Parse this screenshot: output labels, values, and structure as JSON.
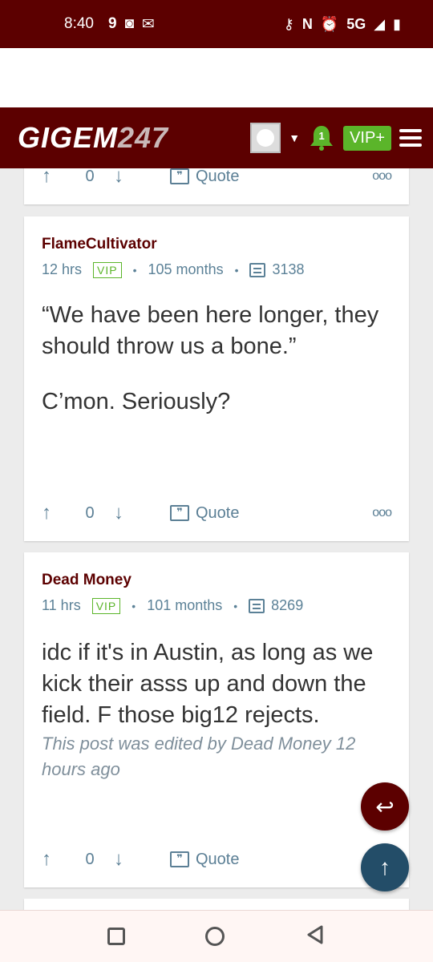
{
  "status_bar": {
    "time": "8:40",
    "network": "5G"
  },
  "site": {
    "logo_main": "GIGEM",
    "logo_num": "247",
    "notification_count": "1",
    "vip_label": "VIP+"
  },
  "posts": [
    {
      "username": "FlameCultivator",
      "time": "12 hrs",
      "vip": "VIP",
      "tenure": "105 months",
      "post_count": "3138",
      "body": [
        "“We have been here longer, they should throw us a bone.”",
        "C’mon. Seriously?"
      ],
      "votes": "0",
      "quote_label": "Quote"
    },
    {
      "username": "Dead Money",
      "time": "11 hrs",
      "vip": "VIP",
      "tenure": "101 months",
      "post_count": "8269",
      "body": [
        "idc if it's in Austin, as long as we kick their asss up and down the field. F those big12 rejects."
      ],
      "edited_note": "This post was edited by Dead Money 12 hours ago",
      "votes": "0",
      "quote_label": "Quote"
    }
  ],
  "partial_post": {
    "votes": "0",
    "quote_label": "Quote"
  },
  "colors": {
    "brand": "#5c0000",
    "accent_green": "#5bb52a",
    "meta": "#5b8197"
  }
}
